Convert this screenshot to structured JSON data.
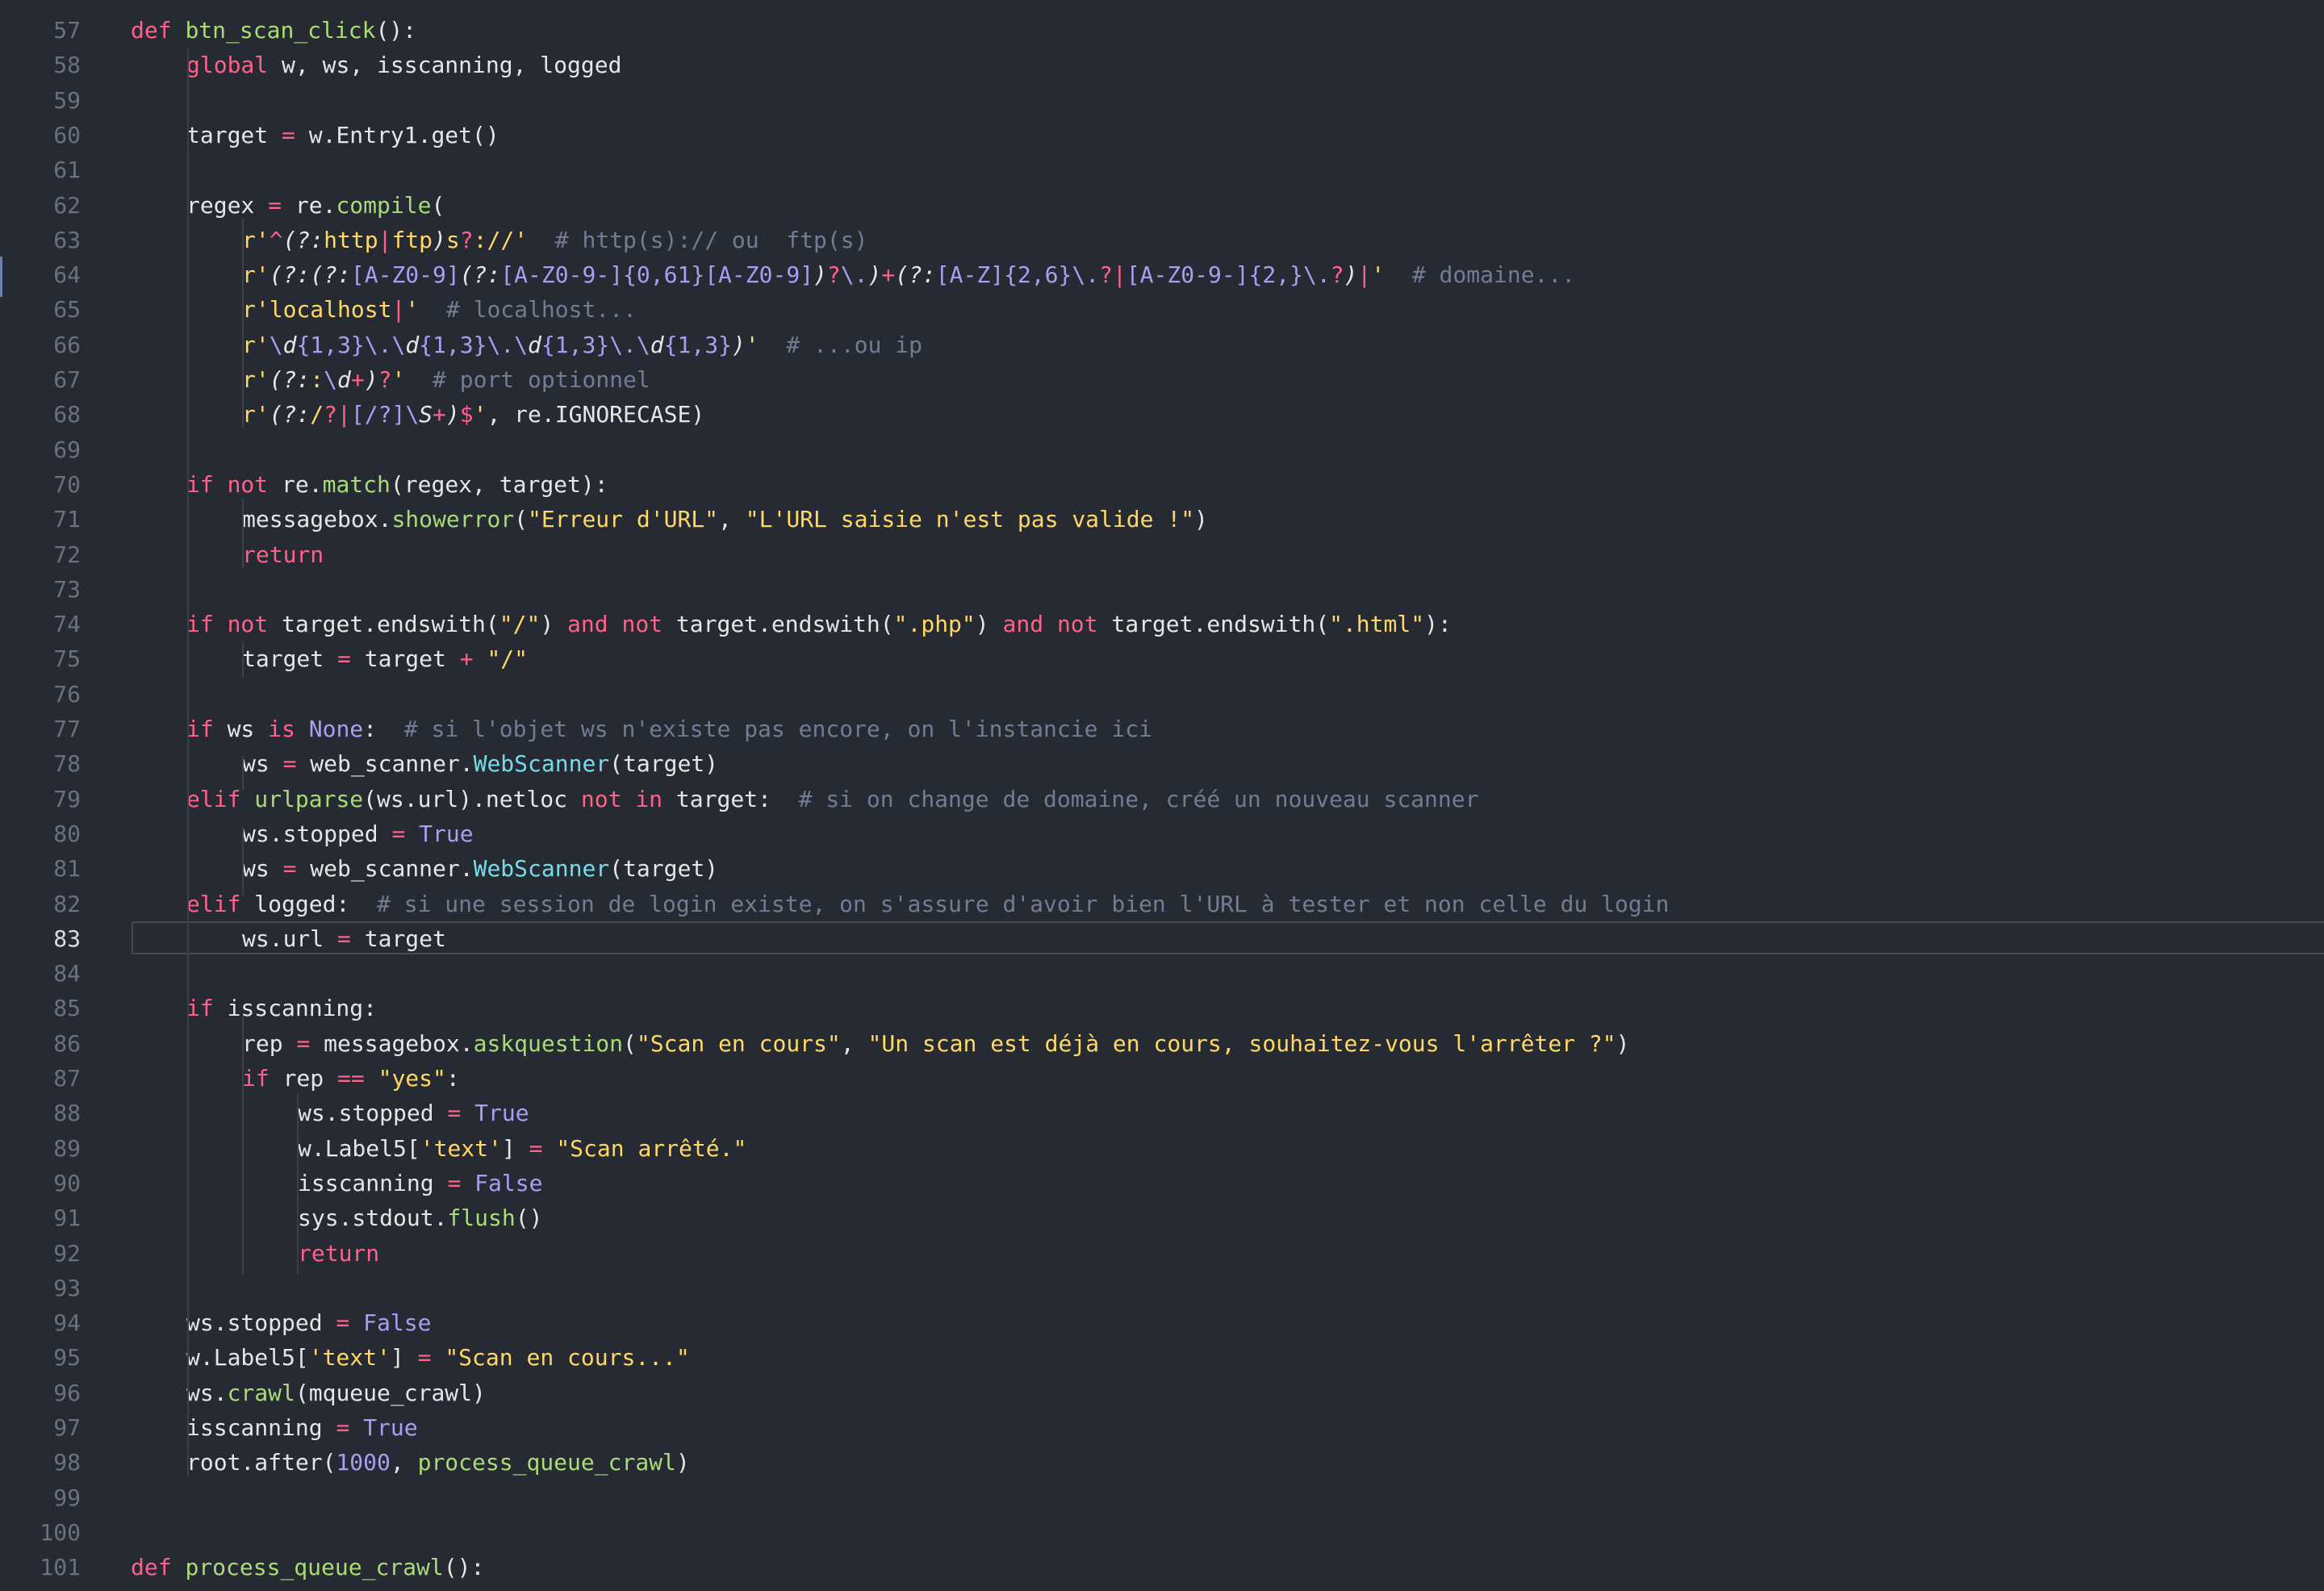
{
  "editor": {
    "colors": {
      "background": "#262a33",
      "keyword": "#ff6188",
      "function": "#a9dc76",
      "string": "#ffd866",
      "comment": "#727c93",
      "constant": "#ab9df2",
      "class": "#78dce8",
      "text": "#e6e6e6",
      "line_number": "#6b717d"
    },
    "current_line": 83,
    "lines": [
      {
        "n": "57",
        "indent": 0,
        "tokens": [
          [
            "def",
            "t-def"
          ],
          [
            " ",
            ""
          ],
          [
            "btn_scan_click",
            "t-fn"
          ],
          [
            "():",
            ""
          ]
        ]
      },
      {
        "n": "58",
        "indent": 1,
        "tokens": [
          [
            "global",
            "t-kw"
          ],
          [
            " w, ws, isscanning, logged",
            ""
          ]
        ]
      },
      {
        "n": "59",
        "indent": 1,
        "tokens": []
      },
      {
        "n": "60",
        "indent": 1,
        "tokens": [
          [
            "target ",
            ""
          ],
          [
            "=",
            "t-op"
          ],
          [
            " w.Entry1.get()",
            ""
          ]
        ]
      },
      {
        "n": "61",
        "indent": 1,
        "tokens": []
      },
      {
        "n": "62",
        "indent": 1,
        "tokens": [
          [
            "regex ",
            ""
          ],
          [
            "=",
            "t-op"
          ],
          [
            " re.",
            ""
          ],
          [
            "compile",
            "t-fn"
          ],
          [
            "(",
            ""
          ]
        ]
      },
      {
        "n": "63",
        "indent": 2,
        "tokens": [
          [
            "r'",
            "t-str"
          ],
          [
            "^",
            "t-rxq"
          ],
          [
            "(?:",
            "t-it"
          ],
          [
            "http",
            "t-str"
          ],
          [
            "|",
            "t-rxq"
          ],
          [
            "ftp",
            "t-str"
          ],
          [
            ")",
            "t-it"
          ],
          [
            "s",
            "t-str"
          ],
          [
            "?",
            "t-rxq"
          ],
          [
            ":",
            "t-str"
          ],
          [
            "//'",
            "t-str"
          ],
          [
            "  ",
            ""
          ],
          [
            "# http(s):// ou  ftp(s)",
            "t-cmt"
          ]
        ]
      },
      {
        "n": "64",
        "indent": 2,
        "tokens": [
          [
            "r'",
            "t-str"
          ],
          [
            "(?:(?:",
            "t-it"
          ],
          [
            "[A-Z0-9]",
            "t-rx"
          ],
          [
            "(?:",
            "t-it"
          ],
          [
            "[A-Z0-9-]",
            "t-rx"
          ],
          [
            "{0,61}",
            "t-rx"
          ],
          [
            "[A-Z0-9]",
            "t-rx"
          ],
          [
            ")",
            "t-it"
          ],
          [
            "?",
            "t-rxq"
          ],
          [
            "\\.",
            "t-rx"
          ],
          [
            ")",
            "t-it"
          ],
          [
            "+",
            "t-rxq"
          ],
          [
            "(?:",
            "t-it"
          ],
          [
            "[A-Z]",
            "t-rx"
          ],
          [
            "{2,6}",
            "t-rx"
          ],
          [
            "\\.",
            "t-rx"
          ],
          [
            "?",
            "t-rxq"
          ],
          [
            "|",
            "t-rxq"
          ],
          [
            "[A-Z0-9-]",
            "t-rx"
          ],
          [
            "{2,}",
            "t-rx"
          ],
          [
            "\\.",
            "t-rx"
          ],
          [
            "?",
            "t-rxq"
          ],
          [
            ")",
            "t-it"
          ],
          [
            "|",
            "t-rxq"
          ],
          [
            "'",
            "t-str"
          ],
          [
            "  ",
            ""
          ],
          [
            "# domaine...",
            "t-cmt"
          ]
        ]
      },
      {
        "n": "65",
        "indent": 2,
        "tokens": [
          [
            "r'",
            "t-str"
          ],
          [
            "localhost",
            "t-str"
          ],
          [
            "|",
            "t-rxq"
          ],
          [
            "'",
            "t-str"
          ],
          [
            "  ",
            ""
          ],
          [
            "# localhost...",
            "t-cmt"
          ]
        ]
      },
      {
        "n": "66",
        "indent": 2,
        "tokens": [
          [
            "r'",
            "t-str"
          ],
          [
            "\\",
            "t-rx"
          ],
          [
            "d",
            "t-it"
          ],
          [
            "{1,3}",
            "t-rx"
          ],
          [
            "\\.\\",
            "t-rx"
          ],
          [
            "d",
            "t-it"
          ],
          [
            "{1,3}",
            "t-rx"
          ],
          [
            "\\.\\",
            "t-rx"
          ],
          [
            "d",
            "t-it"
          ],
          [
            "{1,3}",
            "t-rx"
          ],
          [
            "\\.\\",
            "t-rx"
          ],
          [
            "d",
            "t-it"
          ],
          [
            "{1,3}",
            "t-rx"
          ],
          [
            ")",
            "t-it"
          ],
          [
            "'",
            "t-str"
          ],
          [
            "  ",
            ""
          ],
          [
            "# ...ou ip",
            "t-cmt"
          ]
        ]
      },
      {
        "n": "67",
        "indent": 2,
        "tokens": [
          [
            "r'",
            "t-str"
          ],
          [
            "(?:",
            "t-it"
          ],
          [
            ":",
            "t-str"
          ],
          [
            "\\",
            "t-rx"
          ],
          [
            "d",
            "t-it"
          ],
          [
            "+",
            "t-rxq"
          ],
          [
            ")",
            "t-it"
          ],
          [
            "?",
            "t-rxq"
          ],
          [
            "'",
            "t-str"
          ],
          [
            "  ",
            ""
          ],
          [
            "# port optionnel",
            "t-cmt"
          ]
        ]
      },
      {
        "n": "68",
        "indent": 2,
        "tokens": [
          [
            "r'",
            "t-str"
          ],
          [
            "(?:",
            "t-it"
          ],
          [
            "/",
            "t-str"
          ],
          [
            "?",
            "t-rxq"
          ],
          [
            "|",
            "t-rxq"
          ],
          [
            "[/?]",
            "t-rx"
          ],
          [
            "\\",
            "t-rx"
          ],
          [
            "S",
            "t-it"
          ],
          [
            "+",
            "t-rxq"
          ],
          [
            ")",
            "t-it"
          ],
          [
            "$",
            "t-rxq"
          ],
          [
            "'",
            "t-str"
          ],
          [
            ", re.IGNORECASE)",
            ""
          ]
        ]
      },
      {
        "n": "69",
        "indent": 1,
        "tokens": []
      },
      {
        "n": "70",
        "indent": 1,
        "tokens": [
          [
            "if",
            "t-kw"
          ],
          [
            " ",
            ""
          ],
          [
            "not",
            "t-kw"
          ],
          [
            " re.",
            ""
          ],
          [
            "match",
            "t-fn"
          ],
          [
            "(regex, target):",
            ""
          ]
        ]
      },
      {
        "n": "71",
        "indent": 2,
        "tokens": [
          [
            "messagebox.",
            ""
          ],
          [
            "showerror",
            "t-fn"
          ],
          [
            "(",
            ""
          ],
          [
            "\"Erreur d'URL\"",
            "t-str"
          ],
          [
            ", ",
            ""
          ],
          [
            "\"L'URL saisie n'est pas valide !\"",
            "t-str"
          ],
          [
            ")",
            ""
          ]
        ]
      },
      {
        "n": "72",
        "indent": 2,
        "tokens": [
          [
            "return",
            "t-kw"
          ]
        ]
      },
      {
        "n": "73",
        "indent": 1,
        "tokens": []
      },
      {
        "n": "74",
        "indent": 1,
        "tokens": [
          [
            "if",
            "t-kw"
          ],
          [
            " ",
            ""
          ],
          [
            "not",
            "t-kw"
          ],
          [
            " target.endswith(",
            ""
          ],
          [
            "\"/\"",
            "t-str"
          ],
          [
            ") ",
            ""
          ],
          [
            "and",
            "t-kw"
          ],
          [
            " ",
            ""
          ],
          [
            "not",
            "t-kw"
          ],
          [
            " target.endswith(",
            ""
          ],
          [
            "\".php\"",
            "t-str"
          ],
          [
            ") ",
            ""
          ],
          [
            "and",
            "t-kw"
          ],
          [
            " ",
            ""
          ],
          [
            "not",
            "t-kw"
          ],
          [
            " target.endswith(",
            ""
          ],
          [
            "\".html\"",
            "t-str"
          ],
          [
            "):",
            ""
          ]
        ]
      },
      {
        "n": "75",
        "indent": 2,
        "tokens": [
          [
            "target ",
            ""
          ],
          [
            "=",
            "t-op"
          ],
          [
            " target ",
            ""
          ],
          [
            "+",
            "t-op"
          ],
          [
            " ",
            ""
          ],
          [
            "\"/\"",
            "t-str"
          ]
        ]
      },
      {
        "n": "76",
        "indent": 1,
        "tokens": []
      },
      {
        "n": "77",
        "indent": 1,
        "tokens": [
          [
            "if",
            "t-kw"
          ],
          [
            " ws ",
            ""
          ],
          [
            "is",
            "t-kw"
          ],
          [
            " ",
            ""
          ],
          [
            "None",
            "t-const"
          ],
          [
            ":  ",
            ""
          ],
          [
            "# si l'objet ws n'existe pas encore, on l'instancie ici",
            "t-cmt"
          ]
        ]
      },
      {
        "n": "78",
        "indent": 2,
        "tokens": [
          [
            "ws ",
            ""
          ],
          [
            "=",
            "t-op"
          ],
          [
            " web_scanner.",
            ""
          ],
          [
            "WebScanner",
            "t-cls"
          ],
          [
            "(target)",
            ""
          ]
        ]
      },
      {
        "n": "79",
        "indent": 1,
        "tokens": [
          [
            "elif",
            "t-kw"
          ],
          [
            " ",
            ""
          ],
          [
            "urlparse",
            "t-fn"
          ],
          [
            "(ws.url).netloc ",
            ""
          ],
          [
            "not",
            "t-kw"
          ],
          [
            " ",
            ""
          ],
          [
            "in",
            "t-kw"
          ],
          [
            " target:  ",
            ""
          ],
          [
            "# si on change de domaine, créé un nouveau scanner",
            "t-cmt"
          ]
        ]
      },
      {
        "n": "80",
        "indent": 2,
        "tokens": [
          [
            "ws.stopped ",
            ""
          ],
          [
            "=",
            "t-op"
          ],
          [
            " ",
            ""
          ],
          [
            "True",
            "t-const"
          ]
        ]
      },
      {
        "n": "81",
        "indent": 2,
        "tokens": [
          [
            "ws ",
            ""
          ],
          [
            "=",
            "t-op"
          ],
          [
            " web_scanner.",
            ""
          ],
          [
            "WebScanner",
            "t-cls"
          ],
          [
            "(target)",
            ""
          ]
        ]
      },
      {
        "n": "82",
        "indent": 1,
        "tokens": [
          [
            "elif",
            "t-kw"
          ],
          [
            " logged:  ",
            ""
          ],
          [
            "# si une session de login existe, on s'assure d'avoir bien l'URL à tester et non celle du login",
            "t-cmt"
          ]
        ]
      },
      {
        "n": "83",
        "indent": 2,
        "tokens": [
          [
            "ws.url ",
            ""
          ],
          [
            "=",
            "t-op"
          ],
          [
            " target",
            ""
          ]
        ]
      },
      {
        "n": "84",
        "indent": 1,
        "tokens": []
      },
      {
        "n": "85",
        "indent": 1,
        "tokens": [
          [
            "if",
            "t-kw"
          ],
          [
            " isscanning:",
            ""
          ]
        ]
      },
      {
        "n": "86",
        "indent": 2,
        "tokens": [
          [
            "rep ",
            ""
          ],
          [
            "=",
            "t-op"
          ],
          [
            " messagebox.",
            ""
          ],
          [
            "askquestion",
            "t-fn"
          ],
          [
            "(",
            ""
          ],
          [
            "\"Scan en cours\"",
            "t-str"
          ],
          [
            ", ",
            ""
          ],
          [
            "\"Un scan est déjà en cours, souhaitez-vous l'arrêter ?\"",
            "t-str"
          ],
          [
            ")",
            ""
          ]
        ]
      },
      {
        "n": "87",
        "indent": 2,
        "tokens": [
          [
            "if",
            "t-kw"
          ],
          [
            " rep ",
            ""
          ],
          [
            "==",
            "t-op"
          ],
          [
            " ",
            ""
          ],
          [
            "\"yes\"",
            "t-str"
          ],
          [
            ":",
            ""
          ]
        ]
      },
      {
        "n": "88",
        "indent": 3,
        "tokens": [
          [
            "ws.stopped ",
            ""
          ],
          [
            "=",
            "t-op"
          ],
          [
            " ",
            ""
          ],
          [
            "True",
            "t-const"
          ]
        ]
      },
      {
        "n": "89",
        "indent": 3,
        "tokens": [
          [
            "w.Label5[",
            ""
          ],
          [
            "'text'",
            "t-str"
          ],
          [
            "] ",
            ""
          ],
          [
            "=",
            "t-op"
          ],
          [
            " ",
            ""
          ],
          [
            "\"Scan arrêté.\"",
            "t-str"
          ]
        ]
      },
      {
        "n": "90",
        "indent": 3,
        "tokens": [
          [
            "isscanning ",
            ""
          ],
          [
            "=",
            "t-op"
          ],
          [
            " ",
            ""
          ],
          [
            "False",
            "t-const"
          ]
        ]
      },
      {
        "n": "91",
        "indent": 3,
        "tokens": [
          [
            "sys.stdout.",
            ""
          ],
          [
            "flush",
            "t-fn"
          ],
          [
            "()",
            ""
          ]
        ]
      },
      {
        "n": "92",
        "indent": 3,
        "tokens": [
          [
            "return",
            "t-kw"
          ]
        ]
      },
      {
        "n": "93",
        "indent": 1,
        "tokens": []
      },
      {
        "n": "94",
        "indent": 1,
        "tokens": [
          [
            "ws.stopped ",
            ""
          ],
          [
            "=",
            "t-op"
          ],
          [
            " ",
            ""
          ],
          [
            "False",
            "t-const"
          ]
        ]
      },
      {
        "n": "95",
        "indent": 1,
        "tokens": [
          [
            "w.Label5[",
            ""
          ],
          [
            "'text'",
            "t-str"
          ],
          [
            "] ",
            ""
          ],
          [
            "=",
            "t-op"
          ],
          [
            " ",
            ""
          ],
          [
            "\"Scan en cours...\"",
            "t-str"
          ]
        ]
      },
      {
        "n": "96",
        "indent": 1,
        "tokens": [
          [
            "ws.",
            ""
          ],
          [
            "crawl",
            "t-fn"
          ],
          [
            "(mqueue_crawl)",
            ""
          ]
        ]
      },
      {
        "n": "97",
        "indent": 1,
        "tokens": [
          [
            "isscanning ",
            ""
          ],
          [
            "=",
            "t-op"
          ],
          [
            " ",
            ""
          ],
          [
            "True",
            "t-const"
          ]
        ]
      },
      {
        "n": "98",
        "indent": 1,
        "tokens": [
          [
            "root.after(",
            ""
          ],
          [
            "1000",
            "t-num"
          ],
          [
            ", ",
            ""
          ],
          [
            "process_queue_crawl",
            "t-fn"
          ],
          [
            ")",
            ""
          ]
        ]
      },
      {
        "n": "99",
        "indent": 0,
        "tokens": []
      },
      {
        "n": "100",
        "indent": 0,
        "tokens": []
      },
      {
        "n": "101",
        "indent": 0,
        "tokens": [
          [
            "def",
            "t-def"
          ],
          [
            " ",
            ""
          ],
          [
            "process_queue_crawl",
            "t-fn"
          ],
          [
            "():",
            ""
          ]
        ]
      }
    ]
  }
}
